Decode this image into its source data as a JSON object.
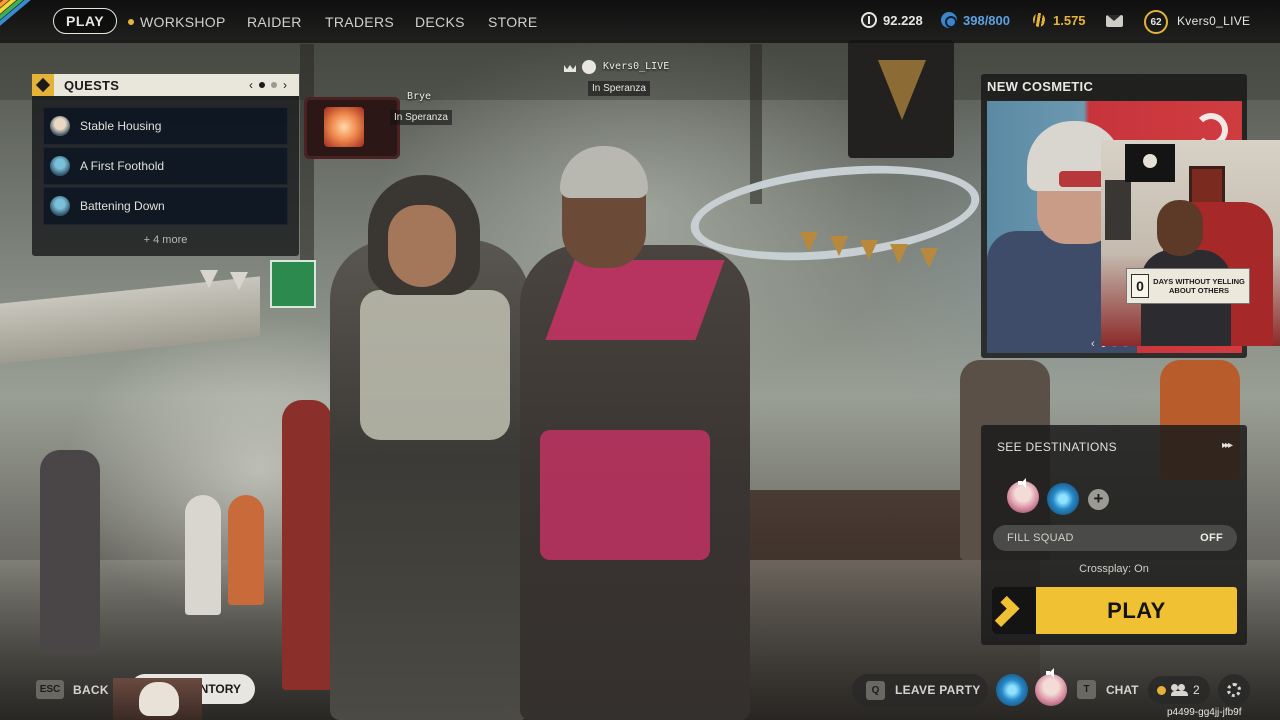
{
  "nav": {
    "play": "PLAY",
    "workshop": "WORKSHOP",
    "raider": "RAIDER",
    "traders": "TRADERS",
    "decks": "DECKS",
    "store": "STORE"
  },
  "currencies": {
    "coins": "92.228",
    "blue": "398/800",
    "gold": "1.575"
  },
  "profile": {
    "level": "62",
    "username": "Kvers0_LIVE"
  },
  "quests": {
    "title": "QUESTS",
    "prev": "‹",
    "next": "›",
    "items": [
      {
        "label": "Stable Housing"
      },
      {
        "label": "A First Foothold"
      },
      {
        "label": "Battening Down"
      }
    ],
    "more": "+ 4 more"
  },
  "players": [
    {
      "name": "Brye",
      "location": "In Speranza"
    },
    {
      "name": "Kvers0_LIVE",
      "location": "In Speranza"
    }
  ],
  "cosmetic": {
    "title": "NEW COSMETIC",
    "prev": "‹",
    "next": "›"
  },
  "webcam_sign": {
    "number": "0",
    "text": "DAYS WITHOUT YELLING ABOUT OTHERS"
  },
  "squad": {
    "see_destinations": "SEE DESTINATIONS",
    "chevrons": "▸▸▸",
    "add": "+",
    "fill_squad": "FILL SQUAD",
    "fill_squad_state": "OFF",
    "crossplay": "Crossplay: On",
    "play": "PLAY"
  },
  "bottom": {
    "back_key": "ESC",
    "back": "BACK",
    "inventory": "NTORY",
    "leave_key": "Q",
    "leave": "LEAVE PARTY",
    "chat_key": "T",
    "chat": "CHAT",
    "friends_count": "2",
    "lobby_code": "p4499-gg4jj-jfb9f"
  },
  "colors": {
    "accent_gold": "#f0c233",
    "quest_header": "#e9e6dc",
    "currency_blue": "#3e86c8"
  },
  "icons": [
    "coin-icon",
    "blue-token-icon",
    "gold-feather-icon",
    "mail-icon",
    "speaker-icon",
    "people-icon",
    "gear-icon",
    "crown-icon",
    "diamond-icon"
  ]
}
